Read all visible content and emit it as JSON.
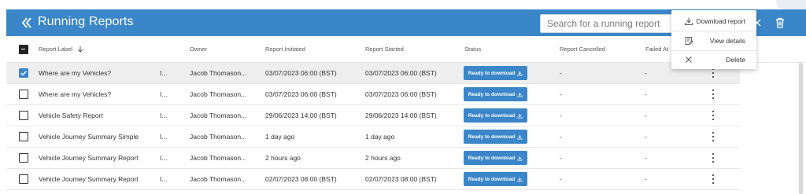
{
  "header": {
    "title": "Running Reports",
    "search_placeholder": "Search for a running report"
  },
  "columns": {
    "label": "Report Label",
    "owner": "Owner",
    "initiated": "Report Initiated",
    "started": "Report Started",
    "status": "Status",
    "cancelled": "Report Cancelled",
    "failed": "Failed At"
  },
  "rows": [
    {
      "label": "Where are my Vehicles?",
      "extra": "I...",
      "owner": "Jacob Thomason...",
      "initiated": "03/07/2023 06:00 (BST)",
      "started": "03/07/2023 06:00 (BST)",
      "status": "Ready to download",
      "cancelled": "-",
      "failed": "-",
      "selected": true
    },
    {
      "label": "Where are my Vehicles?",
      "extra": "I...",
      "owner": "Jacob Thomason...",
      "initiated": "03/07/2023 06:00 (BST)",
      "started": "03/07/2023 06:00 (BST)",
      "status": "Ready to download",
      "cancelled": "-",
      "failed": "-",
      "selected": false
    },
    {
      "label": "Vehicle Safety Report",
      "extra": "I...",
      "owner": "Jacob Thomason...",
      "initiated": "29/06/2023 14:00 (BST)",
      "started": "29/06/2023 14:00 (BST)",
      "status": "Ready to download",
      "cancelled": "-",
      "failed": "-",
      "selected": false
    },
    {
      "label": "Vehicle Journey Summary Simple",
      "extra": "I...",
      "owner": "Jacob Thomason...",
      "initiated": "1 day ago",
      "started": "1 day ago",
      "status": "Ready to download",
      "cancelled": "-",
      "failed": "-",
      "selected": false
    },
    {
      "label": "Vehicle Journey Summary Report",
      "extra": "I...",
      "owner": "Jacob Thomason...",
      "initiated": "2 hours ago",
      "started": "2 hours ago",
      "status": "Ready to download",
      "cancelled": "-",
      "failed": "-",
      "selected": false
    },
    {
      "label": "Vehicle Journey Summary Report",
      "extra": "I...",
      "owner": "Jacob Thomason...",
      "initiated": "02/07/2023 08:00 (BST)",
      "started": "02/07/2023 08:00 (BST)",
      "status": "Ready to download",
      "cancelled": "-",
      "failed": "-",
      "selected": false
    }
  ],
  "context_menu": {
    "download": "Download report",
    "view": "View details",
    "delete": "Delete"
  },
  "icons": {
    "back": "chevron-double-left-icon",
    "close": "close-icon",
    "trash": "trash-icon",
    "sort": "arrow-down-icon",
    "download": "download-icon",
    "details": "document-edit-icon",
    "more": "kebab-icon"
  },
  "colors": {
    "brand": "#3a86c8",
    "selected_row": "#eeeeee"
  }
}
